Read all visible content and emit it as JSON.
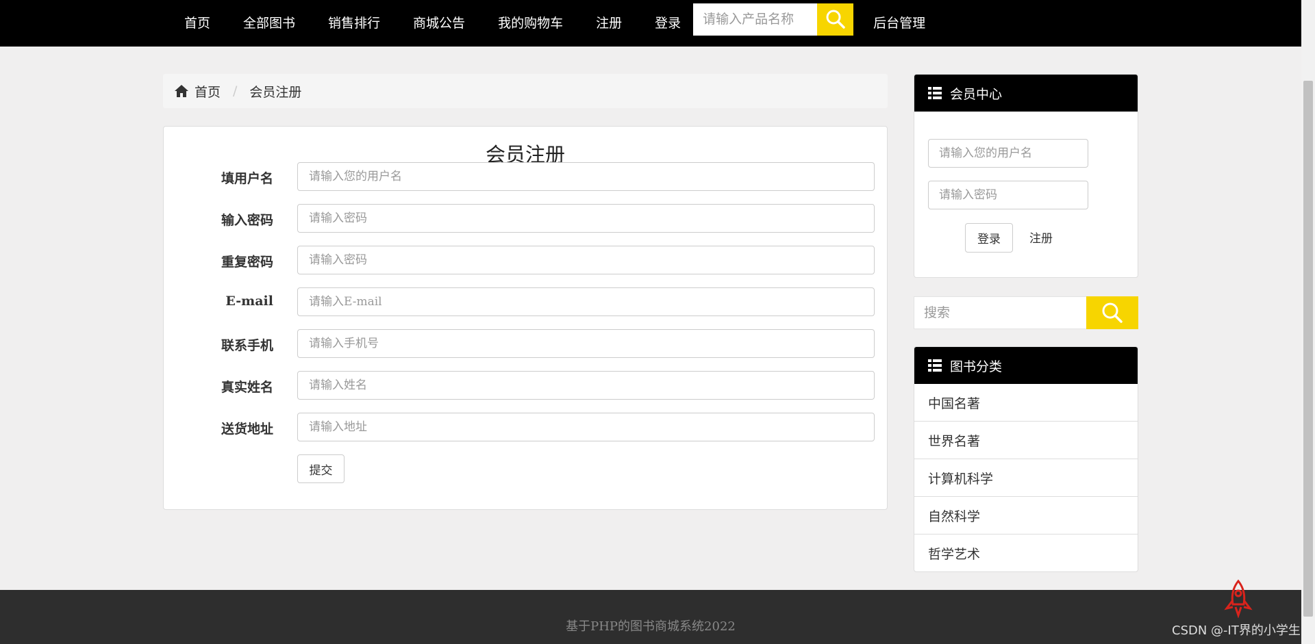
{
  "nav": {
    "items": [
      "首页",
      "全部图书",
      "销售排行",
      "商城公告",
      "我的购物车",
      "注册",
      "登录"
    ],
    "search_placeholder": "请输入产品名称",
    "admin_label": "后台管理"
  },
  "breadcrumb": {
    "home": "首页",
    "separator": "/",
    "current": "会员注册"
  },
  "register": {
    "title": "会员注册",
    "fields": [
      {
        "label": "填用户名",
        "placeholder": "请输入您的用户名"
      },
      {
        "label": "输入密码",
        "placeholder": "请输入密码"
      },
      {
        "label": "重复密码",
        "placeholder": "请输入密码"
      },
      {
        "label": "E-mail",
        "placeholder": "请输入E-mail"
      },
      {
        "label": "联系手机",
        "placeholder": "请输入手机号"
      },
      {
        "label": "真实姓名",
        "placeholder": "请输入姓名"
      },
      {
        "label": "送货地址",
        "placeholder": "请输入地址"
      }
    ],
    "submit_label": "提交"
  },
  "member_center": {
    "title": "会员中心",
    "username_placeholder": "请输入您的用户名",
    "password_placeholder": "请输入密码",
    "login_label": "登录",
    "register_label": "注册"
  },
  "side_search": {
    "placeholder": "搜索"
  },
  "categories": {
    "title": "图书分类",
    "items": [
      "中国名著",
      "世界名著",
      "计算机科学",
      "自然科学",
      "哲学艺术"
    ]
  },
  "footer": {
    "text": "基于PHP的图书商城系统2022"
  },
  "watermark": {
    "text": "CSDN @-IT界的小学生"
  },
  "colors": {
    "accent": "#f7d500",
    "header_bg": "#000000",
    "footer_bg": "#2e2e2e",
    "page_bg": "#f0efef"
  }
}
